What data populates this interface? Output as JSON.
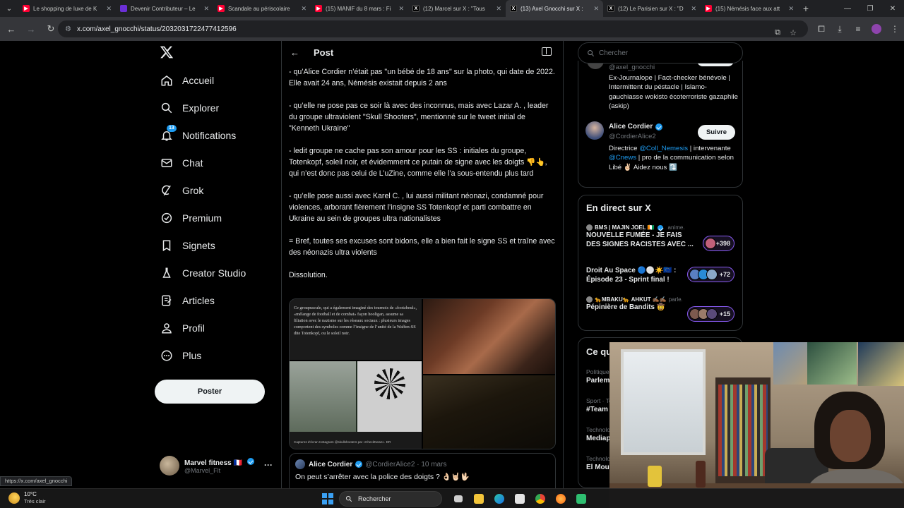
{
  "browser": {
    "tabs": [
      {
        "favicon": "youtube-icon",
        "title": "Le shopping de luxe de K",
        "active": false
      },
      {
        "favicon": "generic-icon",
        "title": "Devenir Contributeur – Le",
        "active": false
      },
      {
        "favicon": "youtube-icon",
        "title": "Scandale au périscolaire",
        "active": false
      },
      {
        "favicon": "youtube-icon",
        "title": "(15) MANIF du 8 mars : Fi",
        "active": false
      },
      {
        "favicon": "x-icon",
        "title": "(12) Marcel sur X : \"Tous",
        "active": false
      },
      {
        "favicon": "x-icon",
        "title": "(13) Axel Gnocchi sur X :",
        "active": true
      },
      {
        "favicon": "x-icon",
        "title": "(12) Le Parisien sur X : \"D",
        "active": false
      },
      {
        "favicon": "youtube-icon",
        "title": "(15) Némésis face aux att",
        "active": false
      }
    ],
    "url": "x.com/axel_gnocchi/status/2032031722477412596",
    "status_url": "https://x.com/axel_gnocchi"
  },
  "nav": {
    "items": [
      {
        "label": "Accueil",
        "icon": "home-icon"
      },
      {
        "label": "Explorer",
        "icon": "search-icon"
      },
      {
        "label": "Notifications",
        "icon": "bell-icon",
        "badge": "13"
      },
      {
        "label": "Chat",
        "icon": "mail-icon"
      },
      {
        "label": "Grok",
        "icon": "grok-icon"
      },
      {
        "label": "Premium",
        "icon": "premium-icon"
      },
      {
        "label": "Signets",
        "icon": "bookmark-icon"
      },
      {
        "label": "Creator Studio",
        "icon": "flask-icon"
      },
      {
        "label": "Articles",
        "icon": "article-icon"
      },
      {
        "label": "Profil",
        "icon": "person-icon"
      },
      {
        "label": "Plus",
        "icon": "more-circle-icon"
      }
    ],
    "post_button": "Poster",
    "account": {
      "name": "Marvel fitness 🇫🇷",
      "handle": "@Marvel_Flt"
    }
  },
  "post": {
    "header_title": "Post",
    "paragraphs": [
      "- qu’Alice Cordier n’était pas \"un bébé de 18 ans\" sur la photo, qui date de 2022. Elle avait 24 ans, Némésis existait depuis 2 ans",
      "- qu’elle ne pose pas ce soir là avec des inconnus, mais avec Lazar A. , leader du groupe ultraviolent \"Skull Shooters\", mentionné sur le tweet initial de \"Kenneth Ukraine\"",
      "- ledit groupe ne cache pas son amour pour les SS : initiales du groupe, Totenkopf, soleil noir, et évidemment ce putain de signe avec les doigts 👎👆, qui n’est donc pas celui de L’uZine, comme elle l’a sous-entendu plus tard",
      "- qu’elle pose aussi avec Karel C. , lui aussi militant néonazi, condamné pour violences, arborant fièrement l’insigne SS Totenkopf et parti combattre en Ukraine au sein de groupes ultra nationalistes",
      "= Bref, toutes ses excuses sont bidons, elle a bien fait le signe SS et traîne avec des néonazis ultra violents",
      "Dissolution."
    ],
    "media_caption_text": "Ce groupuscule, qui a également imaginé des tournois de «footzbeul», «mélange de football et de combat» façon hooligan, assume sa filiation avec le nazisme sur les réseaux sociaux : plusieurs images comportent des symboles comme l’insigne de l’unité de la Waffen-SS dite Totenkopf, ou le soleil noir.",
    "media_credit": "Captures d'écran Instagram @skullshooters par «CheckNews». DR",
    "quote": {
      "name": "Alice Cordier",
      "handle": "@CordierAlice2",
      "date": "· 10 mars",
      "text": "On peut s’arrêter avec la police des doigts ? 👌🏻🤘🏻🖖🏻"
    }
  },
  "sidebar": {
    "search_placeholder": "Chercher",
    "who_to_follow": [
      {
        "handle": "@axel_gnocchi",
        "bio": "Ex-Journalope | Fact-checker bénévole | Intermittent du péstacle | Islamo-gauchiasse wokisto écoterroriste gazaphile (askip)"
      },
      {
        "name": "Alice Cordier",
        "handle": "@CordierAlice2",
        "follow_label": "Suivre",
        "bio_parts": [
          "Directrice ",
          "@Coll_Nemesis",
          " | intervenante ",
          "@Cnews",
          " | pro de la communication selon Libé ✌🏻 Aidez nous ⤵️"
        ]
      }
    ],
    "live_title": "En direct sur X",
    "live": [
      {
        "host": "BMS | MAJIN JOEL 🇨🇮",
        "action": "anime.",
        "title": "NOUVELLE FUMÉE - JE FAIS DES SIGNES RACISTES AVEC ...",
        "count": "+398"
      },
      {
        "host": "",
        "action": "",
        "title": "Droit Au Space 🔵⚪☀️🇪🇺 : Épisode 23 - Sprint final !",
        "count": "+72"
      },
      {
        "host": "🐆MBAKU🐆 AHKUT ✍🏾✍🏾",
        "action": "parle.",
        "title": "Pépinière de Bandits 🤠",
        "count": "+15"
      }
    ],
    "trends_title": "Ce qu",
    "trends": [
      {
        "category": "Politique",
        "name": "Parlem"
      },
      {
        "category": "Sport · Te",
        "name": "#Team"
      },
      {
        "category": "Technolo",
        "name": "Mediap"
      },
      {
        "category": "Technolo",
        "name": "El Moun"
      }
    ]
  },
  "taskbar": {
    "weather_temp": "10°C",
    "weather_desc": "Très clair",
    "search_label": "Rechercher"
  },
  "colors": {
    "accent": "#1d9bf0",
    "background": "#000000",
    "border": "#2f3336",
    "muted": "#71767b",
    "live_pill": "#8b5cf6"
  }
}
